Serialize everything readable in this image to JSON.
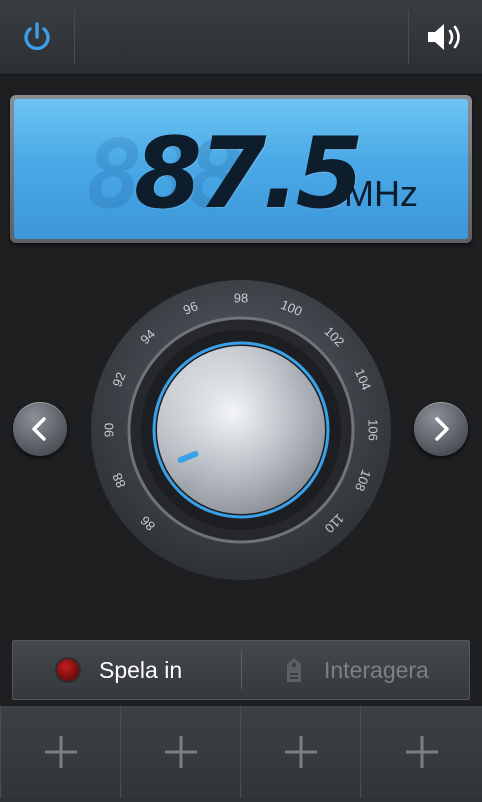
{
  "topbar": {
    "power_icon": "power-icon",
    "volume_icon": "speaker-volume-icon"
  },
  "display": {
    "frequency": "87.5",
    "ghost_digits": "888",
    "unit": "MHz"
  },
  "dial": {
    "labels": [
      "86",
      "88",
      "90",
      "92",
      "94",
      "96",
      "98",
      "100",
      "102",
      "104",
      "106",
      "108",
      "110"
    ],
    "accent_color": "#3aa0e8"
  },
  "actions": {
    "record_label": "Spela in",
    "tag_label": "Interagera"
  },
  "favorites": {
    "slots": [
      "+",
      "+",
      "+",
      "+"
    ]
  }
}
